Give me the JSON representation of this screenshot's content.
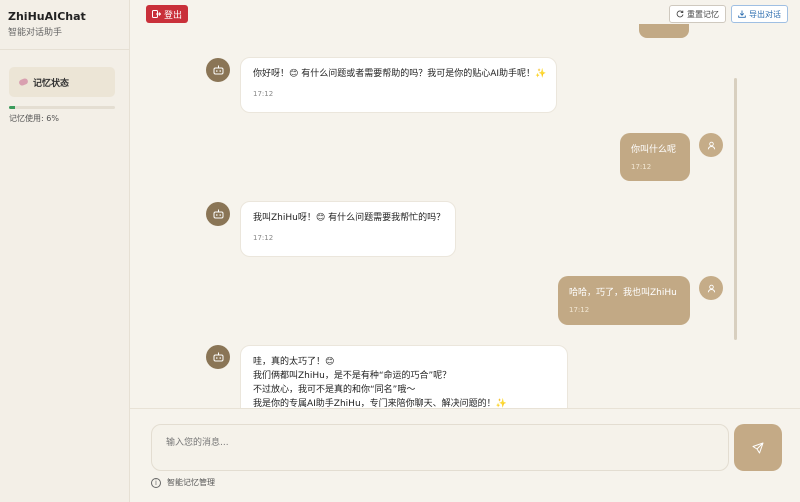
{
  "sidebar": {
    "brand_title": "ZhiHuAIChat",
    "brand_subtitle": "智能对话助手",
    "memory_button": "记忆状态",
    "memory_usage_fraction": 0.06,
    "memory_usage_text": "记忆使用: 6%"
  },
  "header": {
    "logout": "登出",
    "reset_memory": "重置记忆",
    "export_chat": "导出对话"
  },
  "messages": [
    {
      "role": "bot",
      "text": "你好呀！😊 有什么问题或者需要帮助的吗？我可是你的贴心AI助手呢！✨",
      "time": "17:12"
    },
    {
      "role": "user",
      "text": "你叫什么呢",
      "time": "17:12"
    },
    {
      "role": "bot",
      "text": "我叫ZhiHu呀！😊 有什么问题需要我帮忙的吗？",
      "time": "17:12"
    },
    {
      "role": "user",
      "text": "哈哈，巧了，我也叫ZhiHu",
      "time": "17:12"
    },
    {
      "role": "bot",
      "lines": [
        "哇，真的太巧了！😊",
        "我们俩都叫ZhiHu，是不是有种“命运的巧合”呢？",
        "不过放心，我可不是真的和你“同名”哦～",
        "我是你的专属AI助手ZhiHu，专门来陪你聊天、解决问题的！✨"
      ]
    }
  ],
  "composer": {
    "placeholder": "输入您的消息...",
    "memory_link": "智能记忆管理"
  },
  "icons": {
    "logout": "logout-icon",
    "reset": "refresh-icon",
    "export": "download-icon",
    "bot_avatar": "robot-icon",
    "user_avatar": "user-icon",
    "send": "send-icon",
    "info": "info-icon"
  },
  "colors": {
    "accent": "#c2a985",
    "bot_avatar": "#8a7556",
    "logout": "#c9303a",
    "export": "#2f6fb0",
    "memory_bar": "#3b9b5b"
  }
}
